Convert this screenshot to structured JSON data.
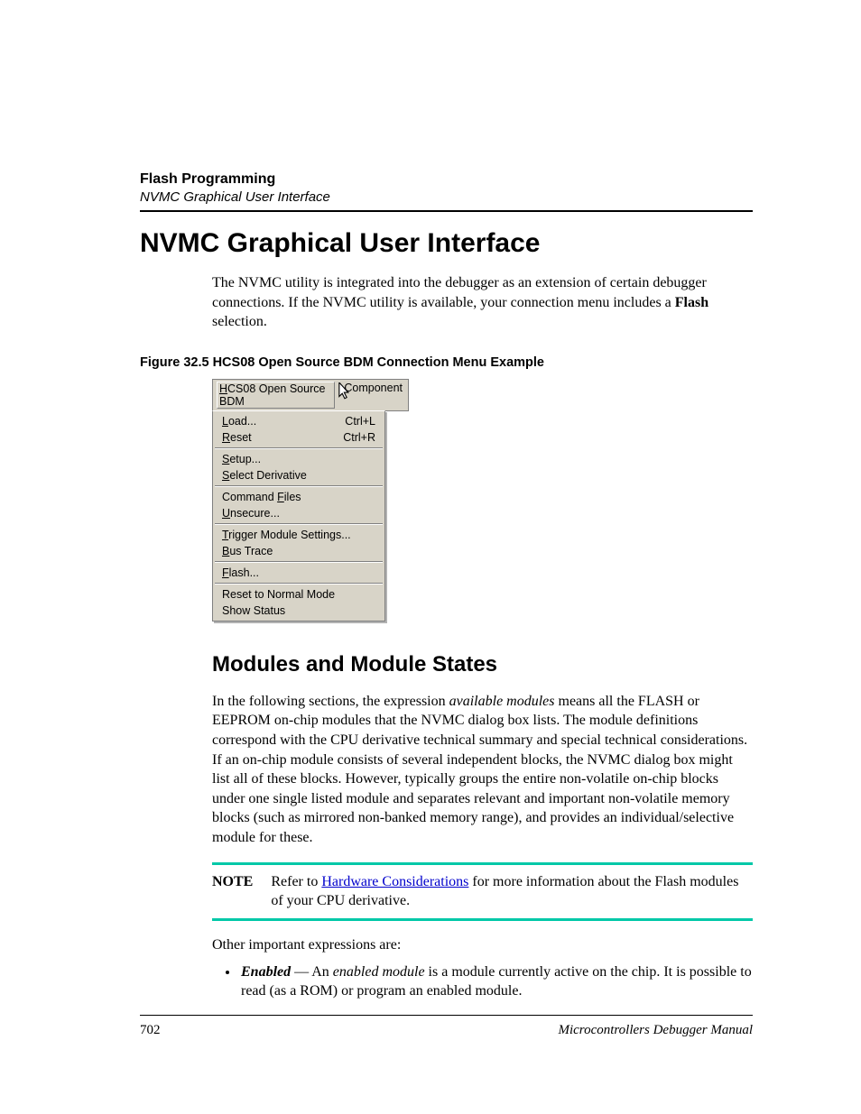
{
  "header": {
    "chapter": "Flash Programming",
    "section": "NVMC Graphical User Interface"
  },
  "title": "NVMC Graphical User Interface",
  "intro": {
    "pre": "The NVMC utility is integrated into the debugger as an extension of certain debugger connections. If the NVMC utility is available, your connection menu includes a ",
    "bold": "Flash",
    "post": " selection."
  },
  "figure": {
    "caption": "Figure 32.5  HCS08 Open Source BDM Connection Menu Example",
    "menubar": {
      "tab1_pre": "H",
      "tab1_rest": "CS08 Open Source BDM",
      "tab2": "Component"
    },
    "menu": {
      "g1": [
        {
          "pre": "L",
          "rest": "oad...",
          "accel": "Ctrl+L"
        },
        {
          "pre": "R",
          "rest": "eset",
          "accel": "Ctrl+R"
        }
      ],
      "g2": [
        {
          "pre": "S",
          "rest": "etup...",
          "accel": ""
        },
        {
          "pre": "S",
          "rest": "elect Derivative",
          "accel": ""
        }
      ],
      "g3": [
        {
          "label_pre": "Command ",
          "u": "F",
          "label_post": "iles",
          "accel": ""
        },
        {
          "pre": "U",
          "rest": "nsecure...",
          "accel": ""
        }
      ],
      "g4": [
        {
          "pre": "T",
          "rest": "rigger Module Settings...",
          "accel": ""
        },
        {
          "pre": "B",
          "rest": "us Trace",
          "accel": ""
        }
      ],
      "g5": [
        {
          "pre": "F",
          "rest": "lash...",
          "accel": ""
        }
      ],
      "g6": [
        {
          "label": "Reset to Normal Mode",
          "accel": ""
        },
        {
          "label": "Show Status",
          "accel": ""
        }
      ]
    }
  },
  "subhead": "Modules and Module States",
  "para1": {
    "pre": "In the following sections, the expression ",
    "em": "available modules",
    "post": " means all the FLASH or EEPROM on-chip modules that the NVMC dialog box lists. The module definitions correspond with the CPU derivative technical summary and special technical considerations. If an on-chip module consists of several independent blocks, the NVMC dialog box might list all of these blocks. However, typically groups the entire non-volatile on-chip blocks under one single listed module and separates relevant and important non-volatile memory blocks (such as mirrored non-banked memory range), and provides an individual/selective module for these."
  },
  "note": {
    "label": "NOTE",
    "pre": "Refer to ",
    "link": "Hardware Considerations",
    "post": " for more information about the Flash modules of your CPU derivative."
  },
  "list_intro": "Other important expressions are:",
  "list": {
    "item1_term": "Enabled",
    "item1_sep": " — An ",
    "item1_em": "enabled module",
    "item1_rest": " is a module currently active on the chip. It is possible to read (as a ROM) or program an enabled module."
  },
  "footer": {
    "page": "702",
    "manual": "Microcontrollers Debugger Manual"
  }
}
